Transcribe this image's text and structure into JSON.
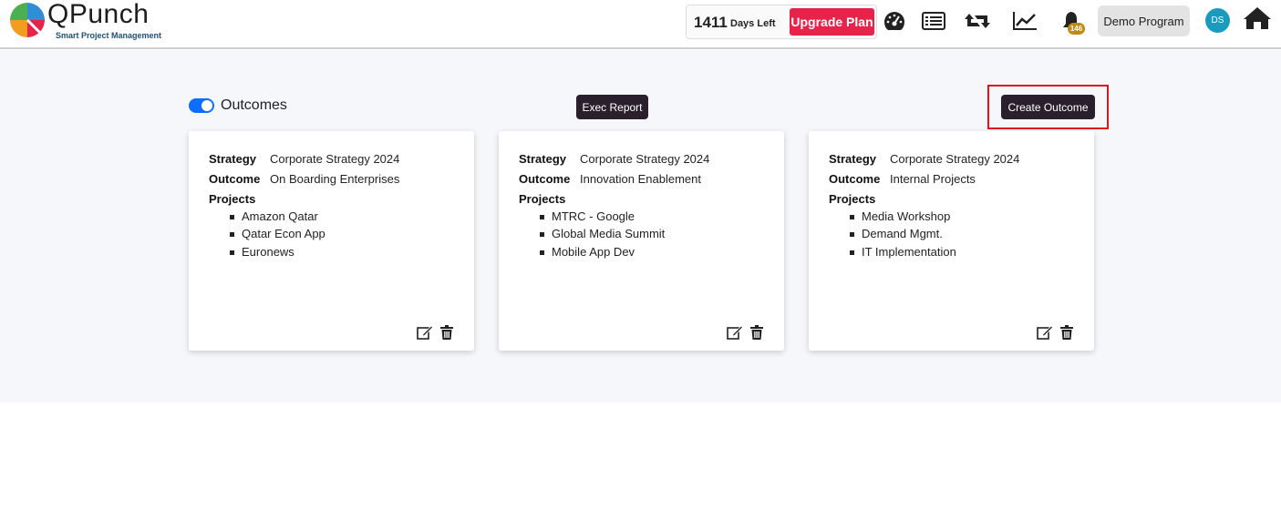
{
  "header": {
    "brand": "QPunch",
    "tagline": "Smart Project Management",
    "days_left_count": "1411",
    "days_left_label": "Days Left",
    "upgrade_label": "Upgrade Plan",
    "notification_count": "146",
    "program_label": "Demo Program",
    "avatar_initials": "DS",
    "icons": [
      "dashboard-icon",
      "list-icon",
      "retweet-icon",
      "chart-line-icon",
      "bell-icon",
      "home-icon"
    ]
  },
  "toolbar": {
    "toggle_on": true,
    "title": "Outcomes",
    "exec_report_label": "Exec Report",
    "create_outcome_label": "Create Outcome"
  },
  "labels": {
    "strategy": "Strategy",
    "outcome": "Outcome",
    "projects": "Projects"
  },
  "cards": [
    {
      "strategy": "Corporate Strategy 2024",
      "outcome": "On Boarding Enterprises",
      "projects": [
        "Amazon Qatar",
        "Qatar Econ App",
        "Euronews"
      ]
    },
    {
      "strategy": "Corporate Strategy 2024",
      "outcome": "Innovation Enablement",
      "projects": [
        "MTRC - Google",
        "Global Media Summit",
        "Mobile App Dev"
      ]
    },
    {
      "strategy": "Corporate Strategy 2024",
      "outcome": "Internal Projects",
      "projects": [
        "Media Workshop",
        "Demand Mgmt.",
        "IT Implementation"
      ]
    }
  ],
  "colors": {
    "accent": "#0d6efd",
    "upgrade": "#e8234a",
    "dark_button": "#2a1f2d",
    "highlight": "#e0141b",
    "badge": "#c08a12",
    "avatar": "#1a9bbd"
  }
}
